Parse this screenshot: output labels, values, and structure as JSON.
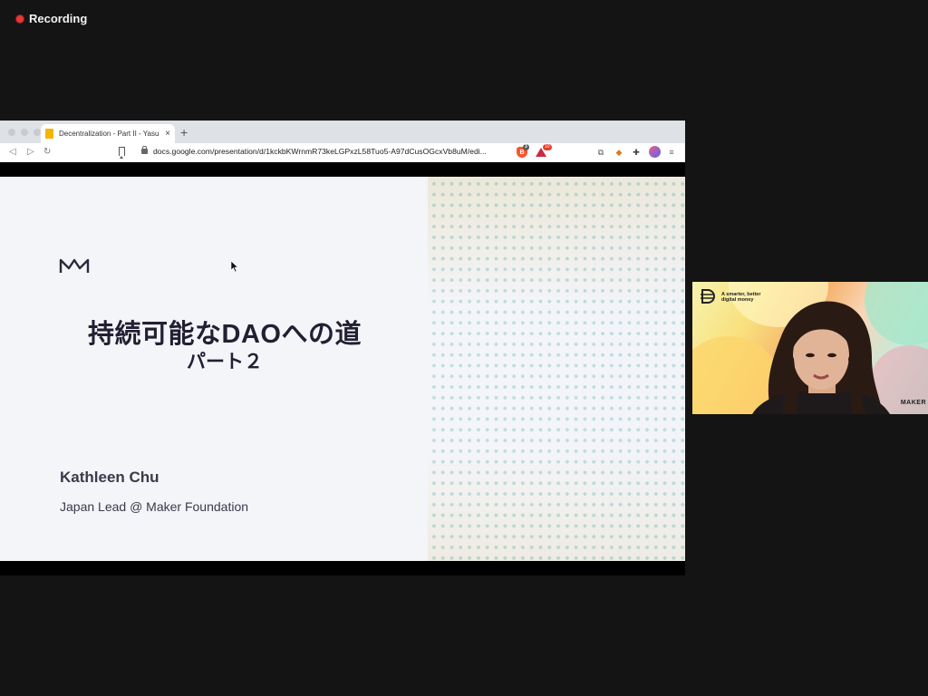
{
  "recording": {
    "label": "Recording"
  },
  "browser": {
    "tab_title": "Decentralization - Part II - Yasu",
    "tab_close": "×",
    "new_tab": "+",
    "url": "docs.google.com/presentation/d/1kckbKWrnmR73keLGPxzL58Tuo5-A97dCusOGcxVb8uM/edi...",
    "extensions": {
      "brave_count": "3",
      "triangle_count": "10"
    }
  },
  "slide": {
    "title": "持続可能なDAOへの道",
    "subtitle": "パート２",
    "presenter_name": "Kathleen Chu",
    "presenter_role": "Japan Lead @ Maker Foundation"
  },
  "webcam": {
    "tagline": "A smarter, better digital money",
    "brand": "MAKER"
  },
  "colors": {
    "accent_red": "#e53935",
    "slide_text": "#231f33",
    "background": "#141414"
  }
}
